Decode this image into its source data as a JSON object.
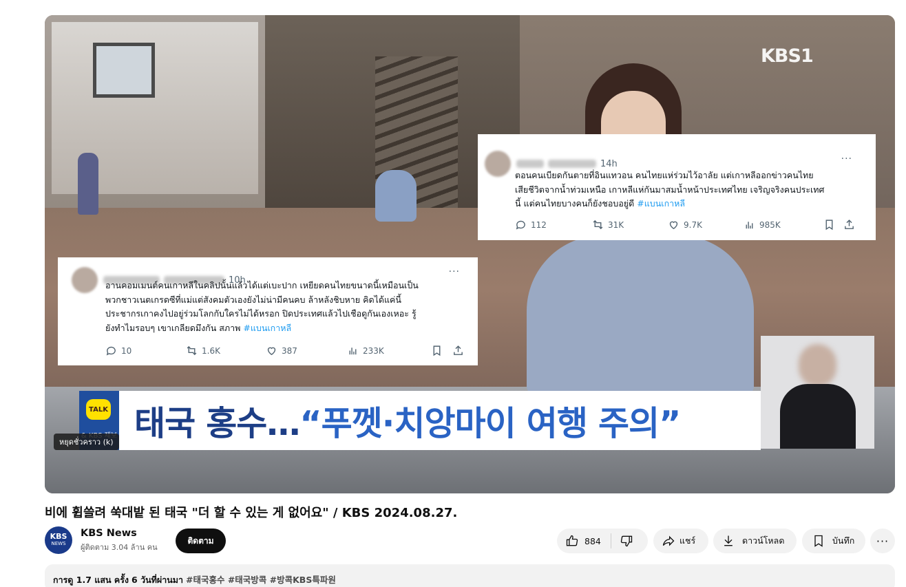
{
  "player": {
    "kbs_logo": "KBS1",
    "tooltip": "หยุดชั่วคราว (k)",
    "tweet_top": {
      "time": "14h",
      "more": "···",
      "line1": "ตอนคนเบียดกันตายที่อินแทวอน คนไทยแห่ร่วมไว้อาลัย  แต่เกาหลีออกข่าวคนไทย",
      "line2": "เสียชีวิตจากน้ำท่วมเหนือ เกาหลีแห่กันมาสมน้ำหน้าประเทศไทย  เจริญจริงคนประเทศ",
      "line3": "นี้  แต่คนไทยบางคนก็ยังชอบอยู่ดี",
      "hashtag": "#แบนเกาหลี",
      "replies": "112",
      "reposts": "31K",
      "likes": "9.7K",
      "views": "985K"
    },
    "tweet_bottom": {
      "time": "10h",
      "more": "···",
      "line1": "อานคอมเมนต์คนเกาหลีในคลิปนั้นแล้วได้แต่เบะปาก  เหยียดคนไทยขนาดนี้เหมือนเป็น",
      "line2": "พวกชาวเนตเกรดซีที่แม่แต่สังคมตัวเองยังไม่น่ามีคนคบ ล้าหลังชิบหาย คิดได้แค่นี้",
      "line3": "ประชากรเกาคงไปอยู่ร่วมโลกกับใครไม่ได้หรอก ปิดประเทศแล้วไปเชือดูกันเองเหอะ รู้",
      "line4": "ยังทำไมรอบๆ เขาเกลียดมึงกัน สภาพ",
      "hashtag": "#แบนเกาหลี",
      "replies": "10",
      "reposts": "1.6K",
      "likes": "387",
      "views": "233K"
    },
    "ticker": {
      "talk_badge": "TALK",
      "talk_text": "& KBS 제보",
      "headline_a": "태국 홍수…",
      "headline_b": "“푸껫·치앙마이 여행 주의”"
    }
  },
  "video": {
    "title": "비에 휩쓸려 쑥대밭 된 태국 \"더 할 수 있는 게 없어요\" / KBS 2024.08.27."
  },
  "channel": {
    "logo_top": "KBS",
    "logo_bottom": "NEWS",
    "name": "KBS News",
    "subscribers": "ผู้ติดตาม 3.04 ล้าน คน",
    "subscribe_label": "ติดตาม"
  },
  "actions": {
    "like_count": "884",
    "share_label": "แชร์",
    "download_label": "ดาวน์โหลด",
    "save_label": "บันทึก",
    "more_label": "···"
  },
  "description": {
    "views": "การดู 1.7 แสน ครั้ง",
    "date": "6 วันที่ผ่านมา",
    "tags": "#태국홍수 #태국방콕 #방콕KBS특파원"
  },
  "colors": {
    "accent_subscribe": "#0f0f0f",
    "hashtag": "#1d9bf0",
    "headline_blue": "#1d3e86"
  }
}
